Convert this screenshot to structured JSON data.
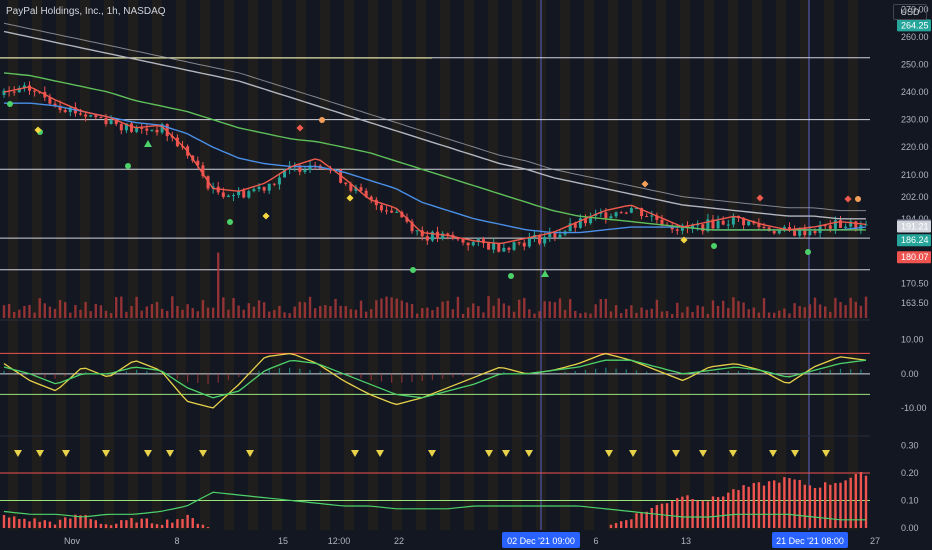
{
  "header": {
    "title": "PayPal Holdings, Inc., 1h, NASDAQ",
    "currency": "USD"
  },
  "colors": {
    "background": "#131722",
    "grid": "#1e222d",
    "up_candle": "#26a69a",
    "down_candle": "#ef5350",
    "ma_blue": "#4a8fe7",
    "ma_red": "#f05a4e",
    "ma_green": "#5fbf5a",
    "ma_grey": "#b2b5be",
    "hline_white": "#d1d4dc",
    "hline_yellow": "#e8e89a",
    "hline_green": "#9be37c",
    "volume": "#b23a3a",
    "session_band": "#2a2418",
    "session_line": "#5b5fc7",
    "axis_text": "#b2b5be",
    "rsi_yellow": "#e8d24a",
    "rsi_green": "#4dd26a"
  },
  "chart_data": [
    {
      "type": "candlestick",
      "panel": "price",
      "title": "PayPal Holdings, Inc., 1h, NASDAQ",
      "ylim": [
        158,
        272
      ],
      "y_ticks": [
        "270.00",
        "260.00",
        "250.00",
        "240.00",
        "230.00",
        "220.00",
        "210.00",
        "202.00",
        "194.00",
        "170.50",
        "163.50"
      ],
      "x_ticks": [
        "Nov",
        "8",
        "15",
        "12:00",
        "22",
        "6",
        "13",
        "27"
      ],
      "x_range_label": [
        "02 Dec '21",
        "09:00",
        "21 Dec '21",
        "08:00"
      ],
      "price_labels": [
        {
          "value": "264.25",
          "color": "#26a69a"
        },
        {
          "value": "191.70",
          "color": "#5a6070"
        },
        {
          "value": "191.21",
          "color": "#d1d4dc"
        },
        {
          "value": "186.24",
          "color": "#26a69a"
        },
        {
          "value": "180.07",
          "color": "#ef5350"
        }
      ],
      "horizontal_levels": [
        {
          "value": 252.5,
          "color": "white"
        },
        {
          "value": 230.0,
          "color": "white"
        },
        {
          "value": 212.0,
          "color": "white"
        },
        {
          "value": 187.0,
          "color": "white"
        },
        {
          "value": 175.5,
          "color": "white"
        }
      ],
      "series": [
        {
          "name": "close",
          "values": [
            239,
            241,
            236,
            232,
            230,
            226,
            227,
            218,
            204,
            203,
            206,
            212,
            215,
            208,
            200,
            197,
            188,
            187,
            185,
            184,
            186,
            188,
            192,
            196,
            198,
            194,
            190,
            192,
            194,
            191,
            189,
            190,
            192,
            191
          ]
        },
        {
          "name": "ma_blue",
          "values": [
            236,
            236,
            235,
            233,
            231,
            229,
            228,
            225,
            220,
            216,
            214,
            213,
            213,
            211,
            208,
            205,
            200,
            197,
            194,
            192,
            190,
            189,
            189,
            190,
            191,
            191,
            191,
            190,
            190,
            190,
            190,
            190,
            190,
            191
          ]
        },
        {
          "name": "ma_green",
          "values": [
            247,
            246,
            244,
            242,
            240,
            237,
            235,
            233,
            230,
            227,
            225,
            223,
            222,
            220,
            218,
            215,
            212,
            209,
            206,
            203,
            200,
            197,
            195,
            194,
            193,
            192,
            191,
            190,
            190,
            190,
            190,
            190,
            190,
            190
          ]
        },
        {
          "name": "ma_grey",
          "values": [
            262,
            260,
            258,
            256,
            254,
            252,
            250,
            248,
            246,
            244,
            241,
            238,
            235,
            232,
            229,
            226,
            223,
            220,
            217,
            214,
            212,
            209,
            207,
            205,
            203,
            201,
            199,
            198,
            197,
            196,
            195,
            195,
            194,
            194
          ]
        }
      ]
    },
    {
      "type": "line",
      "panel": "oscillator",
      "y_ticks": [
        "10.00",
        "0.00",
        "-10.00"
      ],
      "ylim": [
        -17,
        14
      ],
      "levels": [
        6,
        0,
        -6
      ],
      "series": [
        {
          "name": "fast",
          "values": [
            3,
            -2,
            -5,
            2,
            -1,
            4,
            1,
            -8,
            -10,
            -3,
            5,
            6,
            3,
            -2,
            -6,
            -9,
            -7,
            -4,
            -1,
            2,
            0,
            1,
            3,
            6,
            4,
            1,
            -2,
            2,
            3,
            1,
            -3,
            2,
            5,
            4
          ]
        },
        {
          "name": "slow",
          "values": [
            2,
            0,
            -3,
            0,
            0,
            2,
            1,
            -4,
            -7,
            -5,
            1,
            4,
            3,
            0,
            -3,
            -6,
            -7,
            -5,
            -3,
            0,
            0,
            1,
            2,
            4,
            4,
            2,
            0,
            1,
            2,
            1,
            -1,
            1,
            3,
            4
          ]
        }
      ]
    },
    {
      "type": "bar",
      "panel": "histogram",
      "y_ticks": [
        "0.30",
        "0.20",
        "0.10",
        "0.00"
      ],
      "ylim": [
        0,
        0.32
      ],
      "series": [
        {
          "name": "histogram",
          "values": [
            0.04,
            0.03,
            0.02,
            0.05,
            0.01,
            0.03,
            0.02,
            0.04,
            0.0,
            0.0,
            0.0,
            0.0,
            0.0,
            0.0,
            0.0,
            0.0,
            0.0,
            0.0,
            0.0,
            0.0,
            0.0,
            0.0,
            0.0,
            0.0,
            0.04,
            0.08,
            0.12,
            0.1,
            0.14,
            0.16,
            0.18,
            0.15,
            0.17,
            0.2
          ]
        },
        {
          "name": "signal",
          "values": [
            0.06,
            0.05,
            0.05,
            0.04,
            0.05,
            0.05,
            0.06,
            0.08,
            0.13,
            0.12,
            0.11,
            0.1,
            0.09,
            0.08,
            0.08,
            0.07,
            0.07,
            0.07,
            0.08,
            0.08,
            0.08,
            0.08,
            0.08,
            0.07,
            0.06,
            0.05,
            0.04,
            0.04,
            0.05,
            0.05,
            0.05,
            0.04,
            0.03,
            0.03
          ]
        }
      ]
    }
  ]
}
